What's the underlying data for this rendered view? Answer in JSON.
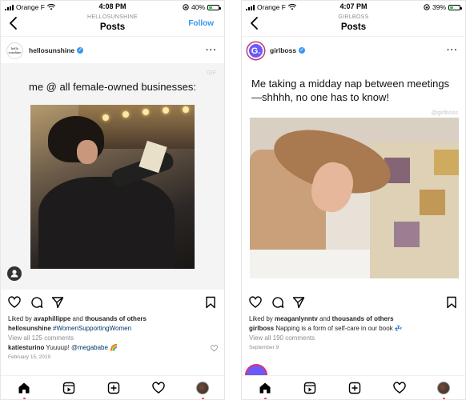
{
  "left": {
    "status": {
      "carrier": "Orange F",
      "time": "4:08 PM",
      "battery": "40%",
      "battery_level": 0.4
    },
    "header": {
      "account": "HELLOSUNSHINE",
      "title": "Posts",
      "follow_label": "Follow"
    },
    "post": {
      "username": "hellosunshine",
      "avatar_text": "hello sunshine",
      "image_caption": "me @ all female-owned businesses:",
      "watermark": "GIF",
      "likes_prefix": "Liked by ",
      "likes_user": "avaphillippe",
      "likes_and": " and ",
      "likes_others": "thousands of others",
      "caption_user": "hellosunshine",
      "caption_hashtag": "#WomenSupportingWomen",
      "view_comments": "View all 125 comments",
      "comment_user": "katiesturino",
      "comment_text": " Yuuuup! ",
      "comment_mention": "@megababe",
      "comment_emoji": "🌈",
      "date": "February 15, 2019"
    },
    "icons": {
      "heart": "heart-icon",
      "comment": "comment-icon",
      "share": "share-icon",
      "bookmark": "bookmark-icon"
    }
  },
  "right": {
    "status": {
      "carrier": "Orange F",
      "time": "4:07 PM",
      "battery": "39%",
      "battery_level": 0.39
    },
    "header": {
      "account": "GIRLBOSS",
      "title": "Posts"
    },
    "post": {
      "username": "girlboss",
      "avatar_letter": "G.",
      "image_caption": "Me taking a midday nap between meetings—shhhh, no one has to know!",
      "watermark": "@girlboss",
      "likes_prefix": "Liked by ",
      "likes_user": "meaganlynntv",
      "likes_and": " and ",
      "likes_others": "thousands of others",
      "caption_user": "girlboss",
      "caption_text": " Napping is a form of self-care in our book ",
      "caption_emoji": "💤",
      "view_comments": "View all 190 comments",
      "date": "September 9"
    }
  },
  "colors": {
    "accent": "#3897f0",
    "notification": "#ed4956",
    "link": "#00376b",
    "muted": "#8e8e8e"
  }
}
